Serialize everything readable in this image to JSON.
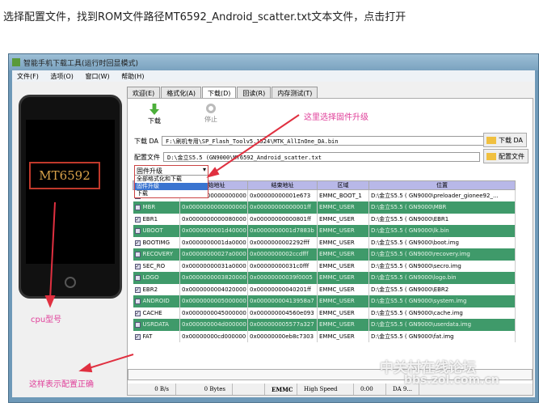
{
  "caption": "选择配置文件，找到ROM文件路径MT6592_Android_scatter.txt文本文件，点击打开",
  "window": {
    "title": "智能手机下载工具(运行时回显模式)",
    "menu": [
      "文件(F)",
      "选项(O)",
      "窗口(W)",
      "帮助(H)"
    ],
    "chip": "MT6592",
    "tabs": [
      "欢迎(E)",
      "格式化(A)",
      "下载(D)",
      "回读(R)",
      "内存测试(T)"
    ],
    "active_tab": "下载(D)",
    "toolbar": {
      "download": "下载",
      "stop": "停止"
    },
    "da": {
      "label": "下载 DA",
      "value": "F:\\刷机专用\\SP_Flash_Toolv5.1524\\MTK_AllInOne_DA.bin",
      "button": "下载 DA"
    },
    "scatter": {
      "label": "配置文件",
      "value": "D:\\金立S5.5 (GN9000\\MT6592_Android_scatter.txt",
      "button": "配置文件"
    },
    "mode": {
      "selected": "固件升级",
      "options": [
        "全部格式化和下载",
        "固件升级",
        "下载"
      ],
      "highlighted": "固件升级"
    },
    "table": {
      "headers": [
        "",
        "开始地址",
        "结束地址",
        "区域",
        "位置"
      ],
      "rows": [
        [
          "PRELOADER",
          "0x0000000000000000",
          "0x00000000001e673",
          "EMMC_BOOT_1",
          "D:\\金立S5.5 ( GN9000\\preloader_gionee92_..."
        ],
        [
          "MBR",
          "0x0000000000000000",
          "0x00000000000001ff",
          "EMMC_USER",
          "D:\\金立S5.5 ( GN9000\\MBR"
        ],
        [
          "EBR1",
          "0x0000000000080000",
          "0x00000000000801ff",
          "EMMC_USER",
          "D:\\金立S5.5 ( GN9000\\EBR1"
        ],
        [
          "UBOOT",
          "0x0000000001d40000",
          "0x0000000001d7883b",
          "EMMC_USER",
          "D:\\金立S5.5 ( GN9000\\lk.bin"
        ],
        [
          "BOOTIMG",
          "0x0000000001da0000",
          "0x0000000002292fff",
          "EMMC_USER",
          "D:\\金立S5.5 ( GN9000\\boot.img"
        ],
        [
          "RECOVERY",
          "0x00000000027a0000",
          "0x0000000002ccdfff",
          "EMMC_USER",
          "D:\\金立S5.5 ( GN9000\\recovery.img"
        ],
        [
          "SEC_RO",
          "0x00000000031a0000",
          "0x00000000031c0fff",
          "EMMC_USER",
          "D:\\金立S5.5 ( GN9000\\secro.img"
        ],
        [
          "LOGO",
          "0x0000000003820000",
          "0x00000000039f0005",
          "EMMC_USER",
          "D:\\金立S5.5 ( GN9000\\logo.bin"
        ],
        [
          "EBR2",
          "0x0000000004020000",
          "0x00000000040201ff",
          "EMMC_USER",
          "D:\\金立S5.5 ( GN9000\\EBR2"
        ],
        [
          "ANDROID",
          "0x0000000005000000",
          "0x00000000413958a7",
          "EMMC_USER",
          "D:\\金立S5.5 ( GN9000\\system.img"
        ],
        [
          "CACHE",
          "0x0000000045000000",
          "0x000000004560e093",
          "EMMC_USER",
          "D:\\金立S5.5 ( GN9000\\cache.img"
        ],
        [
          "USRDATA",
          "0x000000004d000000",
          "0x000000005577a327",
          "EMMC_USER",
          "D:\\金立S5.5 ( GN9000\\userdata.img"
        ],
        [
          "FAT",
          "0x00000000cd000000",
          "0x00000000eb8c7303",
          "EMMC_USER",
          "D:\\金立S5.5 ( GN9000\\fat.img"
        ]
      ]
    },
    "status": [
      "0 B/s",
      "0 Bytes",
      "",
      "EMMC",
      "High Speed",
      "0:00",
      "DA 9..."
    ]
  },
  "annotations": {
    "firmware": "这里选择固件升级",
    "cpu": "cpu型号",
    "config_ok": "这样表示配置正确"
  },
  "watermark": {
    "line1": "中关村在线论坛",
    "line2": "bbs.zol.com.cn"
  }
}
